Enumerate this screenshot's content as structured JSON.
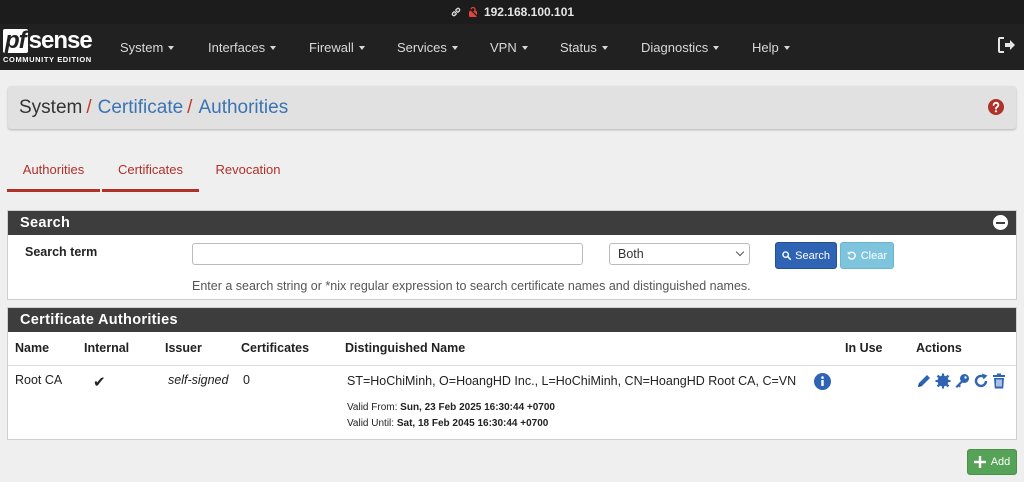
{
  "address": "192.168.100.101",
  "logo": {
    "brand": "pfsense",
    "edition": "COMMUNITY EDITION"
  },
  "nav": [
    {
      "label": "System"
    },
    {
      "label": "Interfaces"
    },
    {
      "label": "Firewall"
    },
    {
      "label": "Services"
    },
    {
      "label": "VPN"
    },
    {
      "label": "Status"
    },
    {
      "label": "Diagnostics"
    },
    {
      "label": "Help"
    }
  ],
  "breadcrumb": {
    "root": "System",
    "sep": "/",
    "level1": "Certificate",
    "level2": "Authorities"
  },
  "tabs": [
    {
      "label": "Authorities",
      "active": true
    },
    {
      "label": "Certificates",
      "active": false
    },
    {
      "label": "Revocation",
      "active": false
    }
  ],
  "search": {
    "heading": "Search",
    "label": "Search term",
    "input_value": "",
    "select_value": "Both",
    "search_button": "Search",
    "clear_button": "Clear",
    "help": "Enter a search string or *nix regular expression to search certificate names and distinguished names."
  },
  "ca_panel": {
    "heading": "Certificate Authorities",
    "columns": [
      "Name",
      "Internal",
      "Issuer",
      "Certificates",
      "Distinguished Name",
      "In Use",
      "Actions"
    ],
    "rows": [
      {
        "name": "Root CA",
        "internal": "✔",
        "issuer": "self-signed",
        "certificates": "0",
        "dn": "ST=HoChiMinh, O=HoangHD Inc., L=HoChiMinh, CN=HoangHD Root CA, C=VN",
        "valid_from_label": "Valid From:",
        "valid_from": "Sun, 23 Feb 2025 16:30:44 +0700",
        "valid_until_label": "Valid Until:",
        "valid_until": "Sat, 18 Feb 2045 16:30:44 +0700",
        "in_use": ""
      }
    ]
  },
  "add_button": "Add",
  "colors": {
    "accent_red": "#b0302a",
    "link_blue": "#3a74b3",
    "nav_bg": "#212121",
    "add_green": "#56a256",
    "action_blue": "#2f64b4"
  }
}
